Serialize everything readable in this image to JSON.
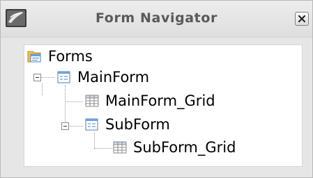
{
  "window": {
    "title": "Form Navigator"
  },
  "icons": {
    "app": "form-navigator-app-icon",
    "close": "close-icon",
    "folder": "forms-folder-icon",
    "form": "form-icon",
    "grid": "grid-control-icon"
  },
  "tree": {
    "root": {
      "label": "Forms"
    },
    "main_form": {
      "label": "MainForm",
      "expanded": true
    },
    "main_form_grid": {
      "label": "MainForm_Grid"
    },
    "sub_form": {
      "label": "SubForm",
      "expanded": true
    },
    "sub_form_grid": {
      "label": "SubForm_Grid"
    }
  }
}
